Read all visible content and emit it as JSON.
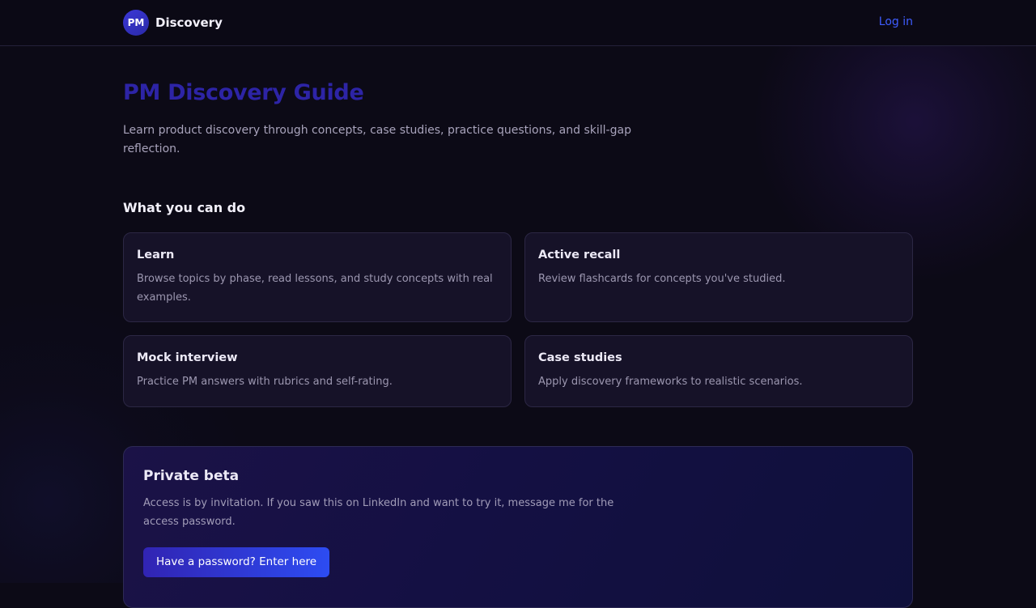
{
  "header": {
    "logo_text": "PM",
    "brand": "Discovery",
    "login_label": "Log in"
  },
  "hero": {
    "title": "PM Discovery Guide",
    "subtitle": "Learn product discovery through concepts, case studies, practice questions, and skill-gap reflection."
  },
  "features": {
    "heading": "What you can do",
    "cards": [
      {
        "title": "Learn",
        "description": "Browse topics by phase, read lessons, and study concepts with real examples."
      },
      {
        "title": "Active recall",
        "description": "Review flashcards for concepts you've studied."
      },
      {
        "title": "Mock interview",
        "description": "Practice PM answers with rubrics and self-rating."
      },
      {
        "title": "Case studies",
        "description": "Apply discovery frameworks to realistic scenarios."
      }
    ]
  },
  "beta": {
    "title": "Private beta",
    "description": "Access is by invitation. If you saw this on LinkedIn and want to try it, message me for the access password.",
    "button_label": "Have a password? Enter here"
  },
  "colors": {
    "background": "#0c0a16",
    "accent_title": "#2d24a6",
    "link": "#3f5dff",
    "card_bg": "#161228",
    "button_gradient_start": "#3124b3",
    "button_gradient_end": "#2d4cf2"
  }
}
